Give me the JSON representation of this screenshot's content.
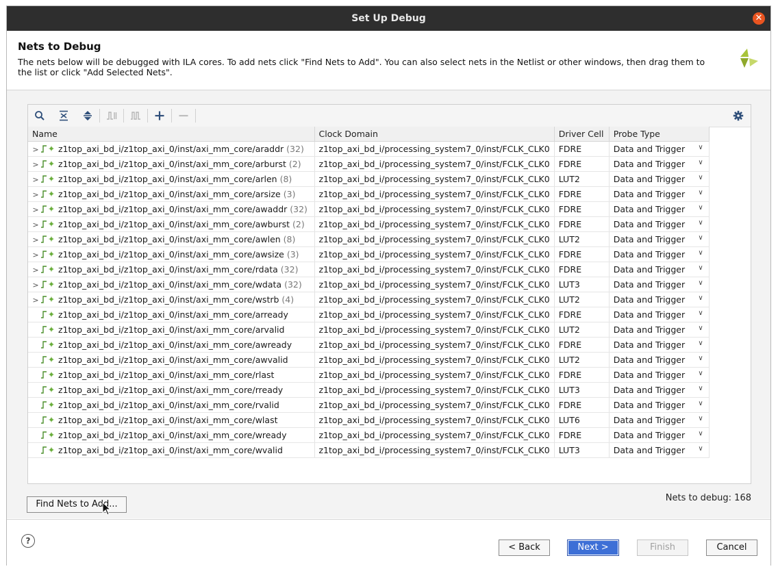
{
  "window": {
    "title": "Set Up Debug"
  },
  "header": {
    "title": "Nets to Debug",
    "description": "The nets below will be debugged with ILA cores. To add nets click \"Find Nets to Add\". You can also select nets in the Netlist or other windows, then drag them to the list or click \"Add Selected Nets\"."
  },
  "toolbar": {
    "icons": [
      "search-icon",
      "collapse-all-icon",
      "expand-all-icon",
      "waveform-icon",
      "pulse-icon",
      "add-icon",
      "remove-icon",
      "settings-icon"
    ]
  },
  "table": {
    "columns": [
      "Name",
      "Clock Domain",
      "Driver Cell",
      "Probe Type"
    ],
    "rows": [
      {
        "name": "z1top_axi_bd_i/z1top_axi_0/inst/axi_mm_core/araddr",
        "bits": "(32)",
        "expand": true,
        "clock": "z1top_axi_bd_i/processing_system7_0/inst/FCLK_CLK0",
        "driver": "FDRE",
        "probe": "Data and Trigger"
      },
      {
        "name": "z1top_axi_bd_i/z1top_axi_0/inst/axi_mm_core/arburst",
        "bits": "(2)",
        "expand": true,
        "clock": "z1top_axi_bd_i/processing_system7_0/inst/FCLK_CLK0",
        "driver": "FDRE",
        "probe": "Data and Trigger"
      },
      {
        "name": "z1top_axi_bd_i/z1top_axi_0/inst/axi_mm_core/arlen",
        "bits": "(8)",
        "expand": true,
        "clock": "z1top_axi_bd_i/processing_system7_0/inst/FCLK_CLK0",
        "driver": "LUT2",
        "probe": "Data and Trigger"
      },
      {
        "name": "z1top_axi_bd_i/z1top_axi_0/inst/axi_mm_core/arsize",
        "bits": "(3)",
        "expand": true,
        "clock": "z1top_axi_bd_i/processing_system7_0/inst/FCLK_CLK0",
        "driver": "FDRE",
        "probe": "Data and Trigger"
      },
      {
        "name": "z1top_axi_bd_i/z1top_axi_0/inst/axi_mm_core/awaddr",
        "bits": "(32)",
        "expand": true,
        "clock": "z1top_axi_bd_i/processing_system7_0/inst/FCLK_CLK0",
        "driver": "FDRE",
        "probe": "Data and Trigger"
      },
      {
        "name": "z1top_axi_bd_i/z1top_axi_0/inst/axi_mm_core/awburst",
        "bits": "(2)",
        "expand": true,
        "clock": "z1top_axi_bd_i/processing_system7_0/inst/FCLK_CLK0",
        "driver": "FDRE",
        "probe": "Data and Trigger"
      },
      {
        "name": "z1top_axi_bd_i/z1top_axi_0/inst/axi_mm_core/awlen",
        "bits": "(8)",
        "expand": true,
        "clock": "z1top_axi_bd_i/processing_system7_0/inst/FCLK_CLK0",
        "driver": "LUT2",
        "probe": "Data and Trigger"
      },
      {
        "name": "z1top_axi_bd_i/z1top_axi_0/inst/axi_mm_core/awsize",
        "bits": "(3)",
        "expand": true,
        "clock": "z1top_axi_bd_i/processing_system7_0/inst/FCLK_CLK0",
        "driver": "FDRE",
        "probe": "Data and Trigger"
      },
      {
        "name": "z1top_axi_bd_i/z1top_axi_0/inst/axi_mm_core/rdata",
        "bits": "(32)",
        "expand": true,
        "clock": "z1top_axi_bd_i/processing_system7_0/inst/FCLK_CLK0",
        "driver": "FDRE",
        "probe": "Data and Trigger"
      },
      {
        "name": "z1top_axi_bd_i/z1top_axi_0/inst/axi_mm_core/wdata",
        "bits": "(32)",
        "expand": true,
        "clock": "z1top_axi_bd_i/processing_system7_0/inst/FCLK_CLK0",
        "driver": "LUT3",
        "probe": "Data and Trigger"
      },
      {
        "name": "z1top_axi_bd_i/z1top_axi_0/inst/axi_mm_core/wstrb",
        "bits": "(4)",
        "expand": true,
        "clock": "z1top_axi_bd_i/processing_system7_0/inst/FCLK_CLK0",
        "driver": "LUT2",
        "probe": "Data and Trigger"
      },
      {
        "name": "z1top_axi_bd_i/z1top_axi_0/inst/axi_mm_core/arready",
        "bits": "",
        "expand": false,
        "clock": "z1top_axi_bd_i/processing_system7_0/inst/FCLK_CLK0",
        "driver": "FDRE",
        "probe": "Data and Trigger"
      },
      {
        "name": "z1top_axi_bd_i/z1top_axi_0/inst/axi_mm_core/arvalid",
        "bits": "",
        "expand": false,
        "clock": "z1top_axi_bd_i/processing_system7_0/inst/FCLK_CLK0",
        "driver": "LUT2",
        "probe": "Data and Trigger"
      },
      {
        "name": "z1top_axi_bd_i/z1top_axi_0/inst/axi_mm_core/awready",
        "bits": "",
        "expand": false,
        "clock": "z1top_axi_bd_i/processing_system7_0/inst/FCLK_CLK0",
        "driver": "FDRE",
        "probe": "Data and Trigger"
      },
      {
        "name": "z1top_axi_bd_i/z1top_axi_0/inst/axi_mm_core/awvalid",
        "bits": "",
        "expand": false,
        "clock": "z1top_axi_bd_i/processing_system7_0/inst/FCLK_CLK0",
        "driver": "LUT2",
        "probe": "Data and Trigger"
      },
      {
        "name": "z1top_axi_bd_i/z1top_axi_0/inst/axi_mm_core/rlast",
        "bits": "",
        "expand": false,
        "clock": "z1top_axi_bd_i/processing_system7_0/inst/FCLK_CLK0",
        "driver": "FDRE",
        "probe": "Data and Trigger"
      },
      {
        "name": "z1top_axi_bd_i/z1top_axi_0/inst/axi_mm_core/rready",
        "bits": "",
        "expand": false,
        "clock": "z1top_axi_bd_i/processing_system7_0/inst/FCLK_CLK0",
        "driver": "LUT3",
        "probe": "Data and Trigger"
      },
      {
        "name": "z1top_axi_bd_i/z1top_axi_0/inst/axi_mm_core/rvalid",
        "bits": "",
        "expand": false,
        "clock": "z1top_axi_bd_i/processing_system7_0/inst/FCLK_CLK0",
        "driver": "FDRE",
        "probe": "Data and Trigger"
      },
      {
        "name": "z1top_axi_bd_i/z1top_axi_0/inst/axi_mm_core/wlast",
        "bits": "",
        "expand": false,
        "clock": "z1top_axi_bd_i/processing_system7_0/inst/FCLK_CLK0",
        "driver": "LUT6",
        "probe": "Data and Trigger"
      },
      {
        "name": "z1top_axi_bd_i/z1top_axi_0/inst/axi_mm_core/wready",
        "bits": "",
        "expand": false,
        "clock": "z1top_axi_bd_i/processing_system7_0/inst/FCLK_CLK0",
        "driver": "FDRE",
        "probe": "Data and Trigger"
      },
      {
        "name": "z1top_axi_bd_i/z1top_axi_0/inst/axi_mm_core/wvalid",
        "bits": "",
        "expand": false,
        "clock": "z1top_axi_bd_i/processing_system7_0/inst/FCLK_CLK0",
        "driver": "LUT3",
        "probe": "Data and Trigger"
      }
    ]
  },
  "actions": {
    "find_nets": "Find Nets to Add...",
    "nets_count": "Nets to debug: 168"
  },
  "footer": {
    "help": "?",
    "back": "< Back",
    "next": "Next >",
    "finish": "Finish",
    "cancel": "Cancel"
  },
  "colors": {
    "titlebar": "#2e2e2e",
    "close": "#e95420",
    "primary": "#3d6fd6",
    "logo": "#a8c43a"
  }
}
